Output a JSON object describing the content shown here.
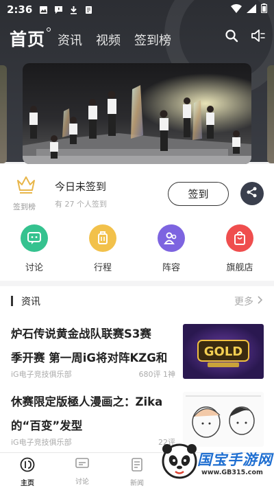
{
  "status_bar": {
    "time": "2:36"
  },
  "header": {
    "home_label": "首页",
    "tabs": [
      "资讯",
      "视频",
      "签到榜"
    ]
  },
  "checkin": {
    "rank_label": "签到榜",
    "title": "今日未签到",
    "subtitle": "有 27 个人签到",
    "button_label": "签到"
  },
  "shortcuts": [
    {
      "label": "讨论",
      "icon": "chat-icon",
      "color": "#35c28f"
    },
    {
      "label": "行程",
      "icon": "luggage-icon",
      "color": "#f2c14b"
    },
    {
      "label": "阵容",
      "icon": "team-icon",
      "color": "#7d64e0"
    },
    {
      "label": "旗舰店",
      "icon": "shopping-bag-icon",
      "color": "#ef4e4e"
    }
  ],
  "news": {
    "section_title": "资讯",
    "more_label": "更多",
    "articles": [
      {
        "line1": "炉石传说黄金战队联赛S3赛",
        "line2": "季开赛 第一周iG将对阵KZG和",
        "source": "iG电子竞技俱乐部",
        "stats": "680评 1神",
        "thumb_text": "GOLD"
      },
      {
        "line1": "休赛限定版極人漫画之：Zika",
        "line2": "的“百变”发型",
        "source": "iG电子竞技俱乐部",
        "stats": "22评"
      }
    ]
  },
  "tabbar": {
    "items": [
      "主页",
      "讨论",
      "新闻"
    ]
  },
  "watermark": {
    "brand": "国宝手游网",
    "url": "www.GB315.com"
  },
  "colors": {
    "header_bg": "#2c2e33",
    "accent_gold": "#e8b64a",
    "share_bg": "#3a3f4d",
    "watermark_blue": "#1f6fd1"
  }
}
